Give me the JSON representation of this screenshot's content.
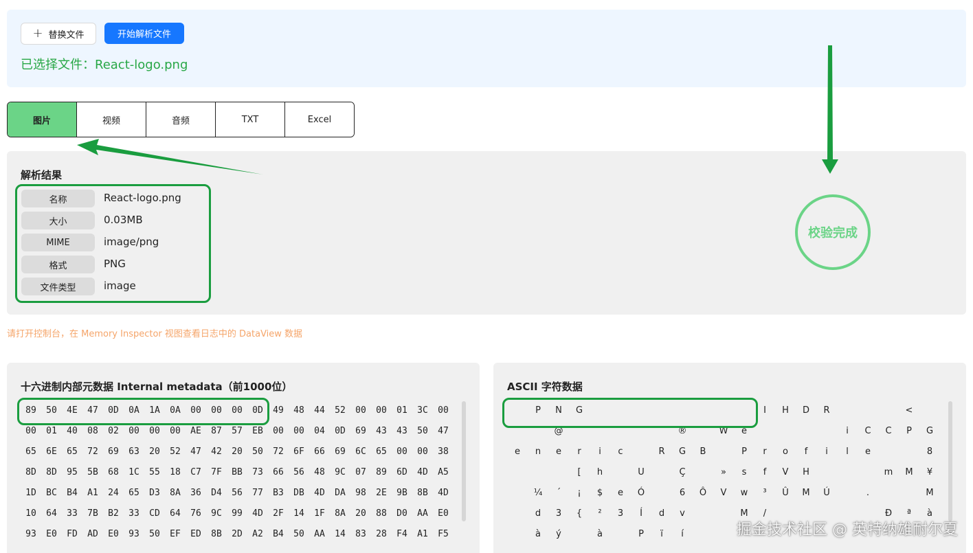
{
  "upload": {
    "replace_label": "替换文件",
    "parse_label": "开始解析文件",
    "selected_text": "已选择文件：React-logo.png"
  },
  "tabs": [
    "图片",
    "视频",
    "音频",
    "TXT",
    "Excel"
  ],
  "active_tab": "图片",
  "result": {
    "title": "解析结果",
    "rows": [
      {
        "label": "名称",
        "value": "React-logo.png"
      },
      {
        "label": "大小",
        "value": "0.03MB"
      },
      {
        "label": "MIME",
        "value": "image/png"
      },
      {
        "label": "格式",
        "value": "PNG"
      },
      {
        "label": "文件类型",
        "value": "image"
      }
    ],
    "verify_label": "校验完成"
  },
  "hint": "请打开控制台，在 Memory Inspector 视图查看日志中的 DataView 数据",
  "hex_panel": {
    "title": "十六进制内部元数据 Internal metadata（前1000位）",
    "rows": [
      [
        "89",
        "50",
        "4E",
        "47",
        "0D",
        "0A",
        "1A",
        "0A",
        "00",
        "00",
        "00",
        "0D",
        "49",
        "48",
        "44",
        "52",
        "00",
        "00",
        "01",
        "3C",
        "00"
      ],
      [
        "00",
        "01",
        "40",
        "08",
        "02",
        "00",
        "00",
        "00",
        "AE",
        "87",
        "57",
        "EB",
        "00",
        "00",
        "04",
        "0D",
        "69",
        "43",
        "43",
        "50",
        "47"
      ],
      [
        "65",
        "6E",
        "65",
        "72",
        "69",
        "63",
        "20",
        "52",
        "47",
        "42",
        "20",
        "50",
        "72",
        "6F",
        "66",
        "69",
        "6C",
        "65",
        "00",
        "00",
        "38"
      ],
      [
        "8D",
        "8D",
        "95",
        "5B",
        "68",
        "1C",
        "55",
        "18",
        "C7",
        "7F",
        "BB",
        "73",
        "66",
        "56",
        "48",
        "9C",
        "07",
        "89",
        "6D",
        "4D",
        "A5"
      ],
      [
        "1D",
        "BC",
        "B4",
        "A1",
        "24",
        "65",
        "D3",
        "8A",
        "36",
        "D4",
        "56",
        "77",
        "B3",
        "DB",
        "4D",
        "DA",
        "98",
        "2E",
        "9B",
        "8B",
        "4D"
      ],
      [
        "10",
        "64",
        "33",
        "7B",
        "B2",
        "33",
        "CD",
        "64",
        "76",
        "9C",
        "99",
        "4D",
        "2F",
        "14",
        "1F",
        "8A",
        "20",
        "88",
        "D0",
        "AA",
        "E0"
      ],
      [
        "93",
        "E0",
        "FD",
        "AD",
        "E0",
        "93",
        "50",
        "EF",
        "ED",
        "8B",
        "2D",
        "A2",
        "B4",
        "50",
        "AA",
        "14",
        "83",
        "28",
        "F4",
        "A1",
        "F5"
      ]
    ]
  },
  "ascii_panel": {
    "title": "ASCII 字符数据",
    "rows": [
      [
        "",
        "P",
        "N",
        "G",
        "",
        "",
        "",
        "",
        "",
        "",
        "",
        "",
        "I",
        "H",
        "D",
        "R",
        "",
        "",
        "",
        "<",
        ""
      ],
      [
        "",
        "",
        "@",
        "",
        "",
        "",
        "",
        "",
        "®",
        "",
        "W",
        "ë",
        "",
        "",
        "",
        "",
        "i",
        "C",
        "C",
        "P",
        "G"
      ],
      [
        "e",
        "n",
        "e",
        "r",
        "i",
        "c",
        "",
        "R",
        "G",
        "B",
        "",
        "P",
        "r",
        "o",
        "f",
        "i",
        "l",
        "e",
        "",
        "",
        "8"
      ],
      [
        "",
        "",
        "",
        "[",
        "h",
        "",
        "U",
        "",
        "Ç",
        "",
        "»",
        "s",
        "f",
        "V",
        "H",
        "",
        "",
        "",
        "m",
        "M",
        "¥"
      ],
      [
        "",
        "¼",
        "´",
        "¡",
        "$",
        "e",
        "Ó",
        "",
        "6",
        "Ô",
        "V",
        "w",
        "³",
        "Û",
        "M",
        "Ú",
        "",
        ".",
        "",
        "",
        "M"
      ],
      [
        "",
        "d",
        "3",
        "{",
        "²",
        "3",
        "Í",
        "d",
        "v",
        "",
        "",
        "M",
        "/",
        "",
        "",
        "",
        "",
        "",
        "Ð",
        "ª",
        "à"
      ],
      [
        "",
        "à",
        "ý",
        "",
        "à",
        "",
        "P",
        "ï",
        "í",
        "",
        "",
        "",
        "",
        "",
        "",
        "",
        "",
        "",
        "",
        "",
        ""
      ]
    ]
  },
  "watermark": "掘金技术社区 @ 英特纳雄耐尔夏",
  "colors": {
    "primary": "#1677ff",
    "success": "#28a745",
    "highlight_border": "#1a9d3f",
    "tab_active": "#6bd487",
    "hint": "#f5a56a"
  }
}
